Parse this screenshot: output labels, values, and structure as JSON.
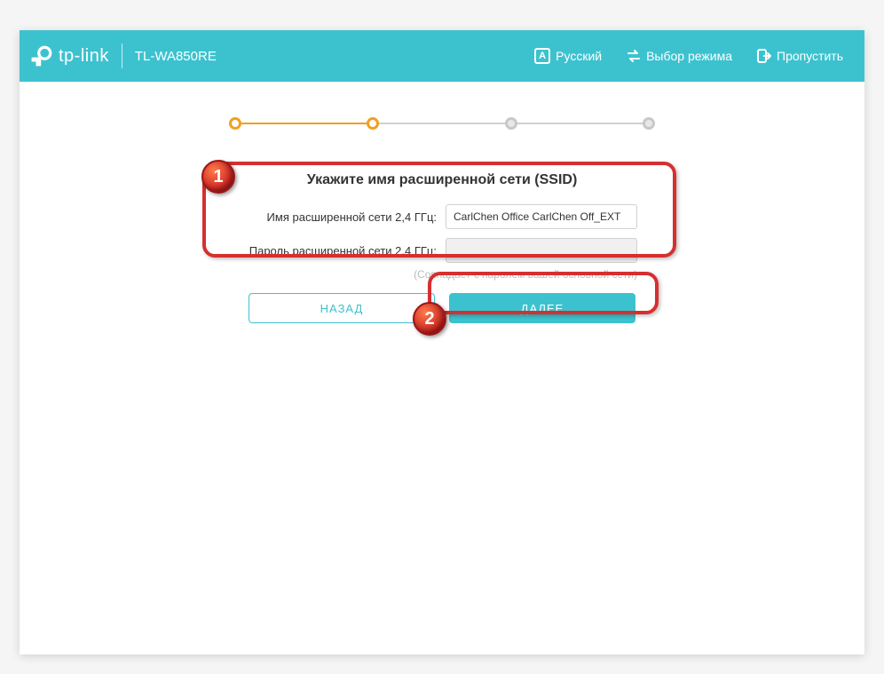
{
  "header": {
    "brand": "tp-link",
    "model": "TL-WA850RE",
    "language_label": "Русский",
    "language_letter": "А",
    "mode_label": "Выбор режима",
    "skip_label": "Пропустить"
  },
  "form": {
    "title": "Укажите имя расширенной сети (SSID)",
    "ssid_label": "Имя расширенной сети 2,4 ГГц:",
    "ssid_value": "CarlChen Office CarlChen Off_EXT",
    "pass_label": "Пароль расширенной сети 2,4 ГГц:",
    "pass_value": "",
    "hint": "(Совпадает с паролем вашей основной сети)"
  },
  "buttons": {
    "back": "НАЗАД",
    "next": "ДАЛЕЕ"
  },
  "annotations": {
    "badge1": "1",
    "badge2": "2"
  }
}
